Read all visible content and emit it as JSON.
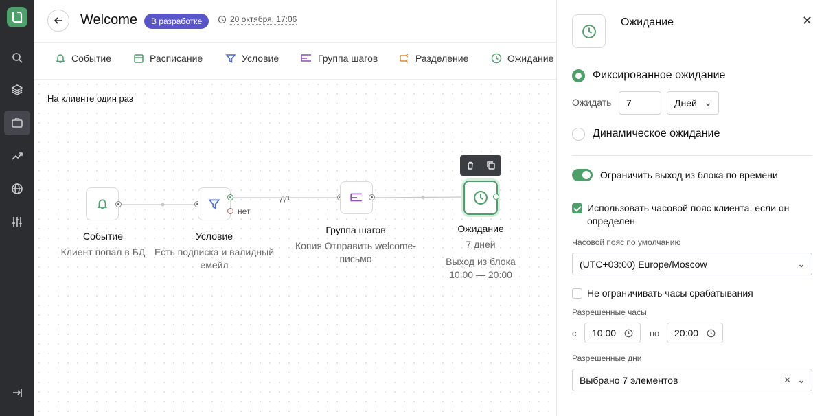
{
  "header": {
    "title": "Welcome",
    "status_badge": "В разработке",
    "timestamp": "20 октября, 17:06"
  },
  "toolbar": {
    "items": [
      {
        "label": "Событие",
        "icon": "bell-icon"
      },
      {
        "label": "Расписание",
        "icon": "calendar-icon"
      },
      {
        "label": "Условие",
        "icon": "filter-icon"
      },
      {
        "label": "Группа шагов",
        "icon": "steps-group-icon"
      },
      {
        "label": "Разделение",
        "icon": "split-icon"
      },
      {
        "label": "Ожидание",
        "icon": "clock-icon"
      }
    ]
  },
  "canvas": {
    "scope_label": "На клиенте один раз",
    "nodes": [
      {
        "title": "Событие",
        "subtitle": "Клиент попал в БД",
        "icon": "bell-icon"
      },
      {
        "title": "Условие",
        "subtitle": "Есть подписка и валидный емейл",
        "icon": "filter-icon"
      },
      {
        "title": "Группа шагов",
        "subtitle": "Копия Отправить welcome-письмо",
        "icon": "steps-group-icon"
      },
      {
        "title": "Ожидание",
        "subtitle": "7 дней",
        "extra": "Выход из блока 10:00 — 20:00",
        "icon": "clock-icon"
      }
    ],
    "edge_labels": {
      "yes": "да",
      "no": "нет"
    }
  },
  "panel": {
    "title": "Ожидание",
    "fixed_wait_label": "Фиксированное ожидание",
    "fixed_wait_selected": true,
    "wait_label": "Ожидать",
    "wait_value": "7",
    "wait_unit": "Дней",
    "dynamic_wait_label": "Динамическое ожидание",
    "limit_exit_label": "Ограничить выход из блока по времени",
    "limit_exit_on": true,
    "client_tz_label": "Использовать часовой пояс клиента, если он определен",
    "client_tz_checked": true,
    "default_tz_label": "Часовой пояс по умолчанию",
    "default_tz_value": "(UTC+03:00) Europe/Moscow",
    "no_limit_hours_label": "Не ограничивать часы срабатывания",
    "no_limit_hours_checked": false,
    "allowed_hours_label": "Разрешенные часы",
    "from_label": "с",
    "from_value": "10:00",
    "to_label": "по",
    "to_value": "20:00",
    "allowed_days_label": "Разрешенные дни",
    "allowed_days_value": "Выбрано 7 элементов"
  },
  "colors": {
    "accent": "#4f9f6b",
    "badge": "#5a56c9",
    "rail": "#2b2d31"
  }
}
